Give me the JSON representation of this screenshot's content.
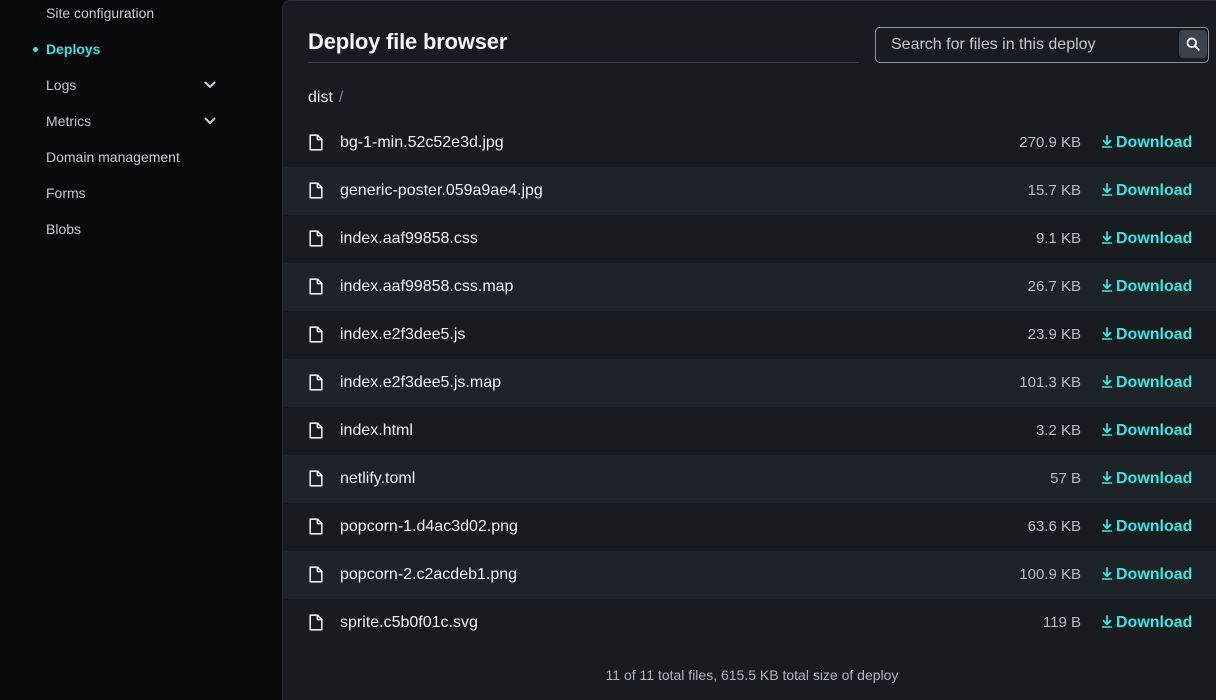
{
  "sidebar": {
    "items": [
      {
        "label": "Site configuration"
      },
      {
        "label": "Deploys"
      },
      {
        "label": "Logs"
      },
      {
        "label": "Metrics"
      },
      {
        "label": "Domain management"
      },
      {
        "label": "Forms"
      },
      {
        "label": "Blobs"
      }
    ]
  },
  "panel": {
    "title": "Deploy file browser",
    "search_placeholder": "Search for files in this deploy",
    "breadcrumb": {
      "folder": "dist",
      "separator": "/"
    },
    "download_label": "Download",
    "files": [
      {
        "name": "bg-1-min.52c52e3d.jpg",
        "size": "270.9 KB"
      },
      {
        "name": "generic-poster.059a9ae4.jpg",
        "size": "15.7 KB"
      },
      {
        "name": "index.aaf99858.css",
        "size": "9.1 KB"
      },
      {
        "name": "index.aaf99858.css.map",
        "size": "26.7 KB"
      },
      {
        "name": "index.e2f3dee5.js",
        "size": "23.9 KB"
      },
      {
        "name": "index.e2f3dee5.js.map",
        "size": "101.3 KB"
      },
      {
        "name": "index.html",
        "size": "3.2 KB"
      },
      {
        "name": "netlify.toml",
        "size": "57 B"
      },
      {
        "name": "popcorn-1.d4ac3d02.png",
        "size": "63.6 KB"
      },
      {
        "name": "popcorn-2.c2acdeb1.png",
        "size": "100.9 KB"
      },
      {
        "name": "sprite.c5b0f01c.svg",
        "size": "119 B"
      }
    ],
    "summary": "11 of 11 total files, 615.5 KB total size of deploy"
  },
  "colors": {
    "accent": "#32e6e2",
    "panel_bg": "#181b20",
    "page_bg": "#06080c"
  }
}
